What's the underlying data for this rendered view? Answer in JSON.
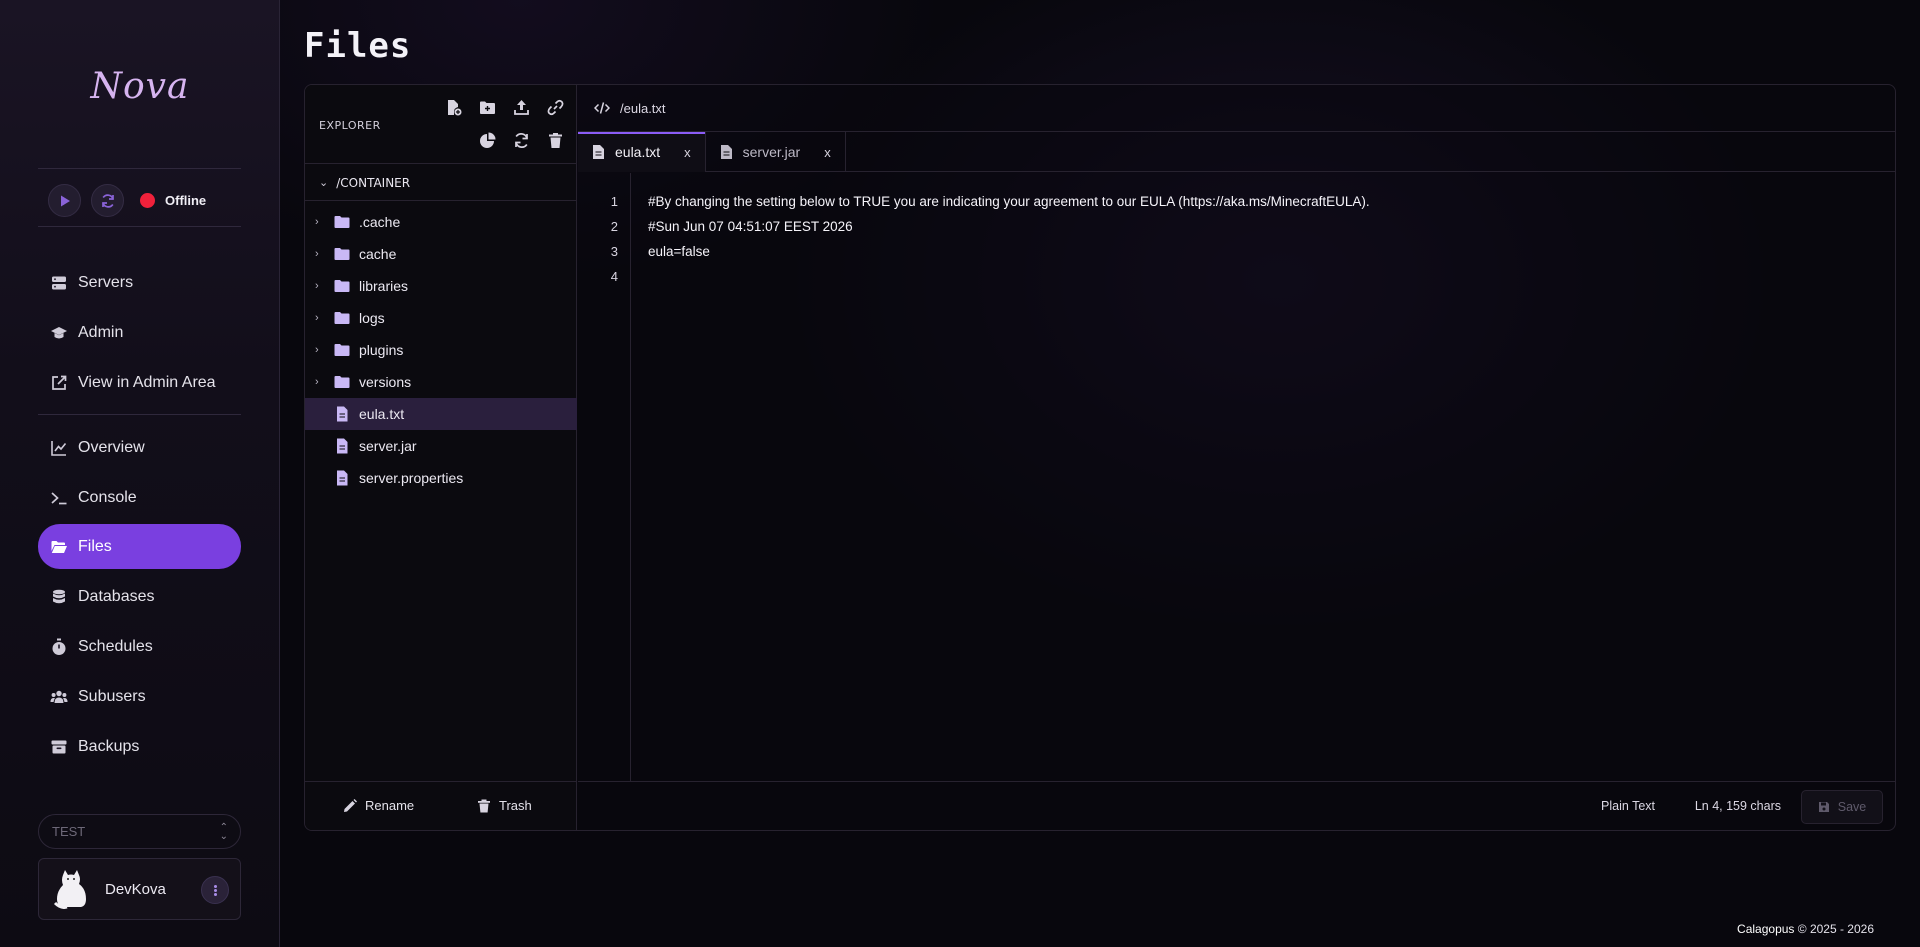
{
  "app": {
    "logo": "Nova",
    "page_title": "Files"
  },
  "server": {
    "status": "Offline",
    "status_color": "#f0213b"
  },
  "sidebar": {
    "nav_primary": [
      {
        "label": "Servers",
        "icon": "server-icon"
      },
      {
        "label": "Admin",
        "icon": "graduation-cap-icon"
      },
      {
        "label": "View in Admin Area",
        "icon": "external-link-icon"
      }
    ],
    "nav_server": [
      {
        "label": "Overview",
        "icon": "chart-line-icon"
      },
      {
        "label": "Console",
        "icon": "terminal-icon"
      },
      {
        "label": "Files",
        "icon": "folder-open-icon",
        "active": true
      },
      {
        "label": "Databases",
        "icon": "database-icon"
      },
      {
        "label": "Schedules",
        "icon": "stopwatch-icon"
      },
      {
        "label": "Subusers",
        "icon": "users-icon"
      },
      {
        "label": "Backups",
        "icon": "archive-box-icon"
      }
    ],
    "server_select": {
      "value": "TEST"
    },
    "user": {
      "name": "DevKova"
    }
  },
  "explorer": {
    "label": "EXPLORER",
    "root": "/CONTAINER",
    "items": [
      {
        "name": ".cache",
        "type": "folder"
      },
      {
        "name": "cache",
        "type": "folder"
      },
      {
        "name": "libraries",
        "type": "folder"
      },
      {
        "name": "logs",
        "type": "folder"
      },
      {
        "name": "plugins",
        "type": "folder"
      },
      {
        "name": "versions",
        "type": "folder"
      },
      {
        "name": "eula.txt",
        "type": "file",
        "selected": true
      },
      {
        "name": "server.jar",
        "type": "file"
      },
      {
        "name": "server.properties",
        "type": "file"
      }
    ],
    "footer": {
      "rename": "Rename",
      "trash": "Trash"
    }
  },
  "editor": {
    "path": "/eula.txt",
    "tabs": [
      {
        "label": "eula.txt",
        "active": true,
        "close": "x"
      },
      {
        "label": "server.jar",
        "active": false,
        "close": "x"
      }
    ],
    "line_numbers": [
      "1",
      "2",
      "3",
      "4"
    ],
    "lines": [
      "#By changing the setting below to TRUE you are indicating your agreement to our EULA (https://aka.ms/MinecraftEULA).",
      "#Sun Jun 07 04:51:07 EEST 2026",
      "eula=false",
      ""
    ],
    "status": {
      "language": "Plain Text",
      "position": "Ln 4, 159 chars",
      "save": "Save"
    }
  },
  "footer": {
    "brand": "Calagopus",
    "copyright": "© 2025 - 2026"
  },
  "colors": {
    "accent": "#7a3fe0",
    "tab_indicator": "#8b5cf6",
    "file_icon": "#c9b8f5"
  }
}
